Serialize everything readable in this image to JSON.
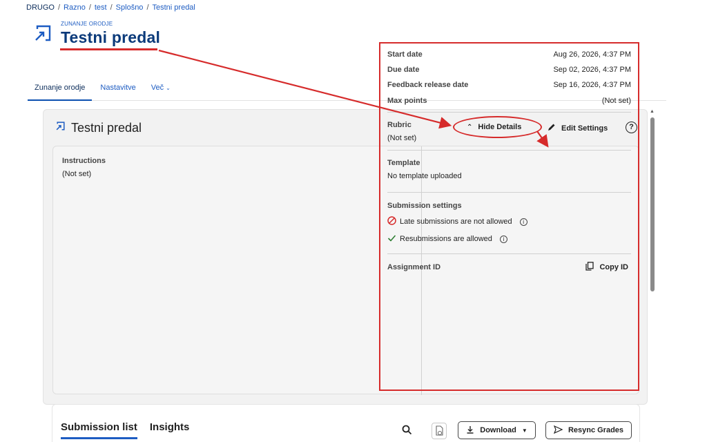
{
  "breadcrumb": [
    "DRUGO",
    "Razno",
    "test",
    "Splošno",
    "Testni predal"
  ],
  "header": {
    "subtitle": "ZUNANJE ORODJE",
    "title": "Testni predal"
  },
  "nav_tabs": [
    "Zunanje orodje",
    "Nastavitve",
    "Več"
  ],
  "panel": {
    "title": "Testni predal",
    "hide_details": "Hide Details",
    "edit_settings": "Edit Settings",
    "help": "?"
  },
  "instructions": {
    "label": "Instructions",
    "value": "(Not set)"
  },
  "details": {
    "start_label": "Start date",
    "start_value": "Aug 26, 2026, 4:37 PM",
    "due_label": "Due date",
    "due_value": "Sep 02, 2026, 4:37 PM",
    "feedback_label": "Feedback release date",
    "feedback_value": "Sep 16, 2026, 4:37 PM",
    "max_label": "Max points",
    "max_value": "(Not set)",
    "rubric_label": "Rubric",
    "rubric_value": "(Not set)",
    "template_label": "Template",
    "template_value": "No template uploaded",
    "submission_label": "Submission settings",
    "late": "Late submissions are not allowed",
    "resub": "Resubmissions are allowed",
    "assignment_label": "Assignment ID",
    "copy_id": "Copy ID"
  },
  "bottom": {
    "tabs": [
      "Submission list",
      "Insights"
    ],
    "download": "Download",
    "resync": "Resync Grades"
  },
  "colors": {
    "brand": "#1d5cc2",
    "title": "#0b3a7a",
    "annotation": "#d62b2b",
    "success": "#2e7d32"
  }
}
